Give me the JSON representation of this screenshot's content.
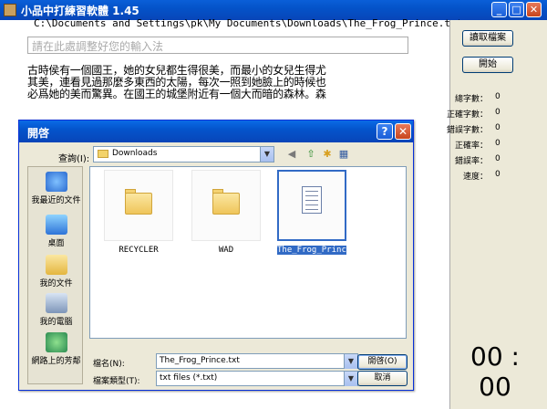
{
  "window": {
    "title": "小品中打練習軟體 1.45"
  },
  "main": {
    "file_path": "C:\\Documents and Settings\\pk\\My Documents\\Downloads\\The_Frog_Prince.txt",
    "ime_placeholder": "請在此處調整好您的輸入法",
    "passage_lines": [
      "古時侯有一個國王，她的女兒都生得很美，而最小的女兒生得尤",
      "其美，連看見過那麼多東西的太陽，每次一照到她臉上的時候也",
      "必爲她的美而驚異。在國王的城堡附近有一個大而暗的森林。森"
    ]
  },
  "sidebar": {
    "read_file_button": "讀取檔案",
    "start_button": "開始",
    "stats": [
      {
        "label": "總字數：",
        "value": "0"
      },
      {
        "label": "正確字數：",
        "value": "0"
      },
      {
        "label": "錯誤字數：",
        "value": "0"
      },
      {
        "label": "正確率：",
        "value": "0"
      },
      {
        "label": "錯誤率：",
        "value": "0"
      },
      {
        "label": "速度：",
        "value": "0"
      }
    ],
    "timer": "00 : 00"
  },
  "dialog": {
    "title": "開啓",
    "look_in_label": "查詢(I):",
    "look_in_value": "Downloads",
    "places": [
      "我最近的文件",
      "桌面",
      "我的文件",
      "我的電腦",
      "網路上的芳鄰"
    ],
    "files": [
      {
        "name": "RECYCLER",
        "kind": "folder"
      },
      {
        "name": "WAD",
        "kind": "folder"
      },
      {
        "name": "The_Frog_Prince.txt",
        "kind": "text-file"
      }
    ],
    "file_name_label": "檔名(N):",
    "file_name_value": "The_Frog_Prince.txt",
    "file_type_label": "檔案類型(T):",
    "file_type_value": "txt files (*.txt)",
    "open_button": "開啓(O)",
    "cancel_button": "取消"
  },
  "colors": {
    "titlebar": "#0454cc",
    "selection": "#316ac5",
    "close_button": "#c8451d"
  }
}
